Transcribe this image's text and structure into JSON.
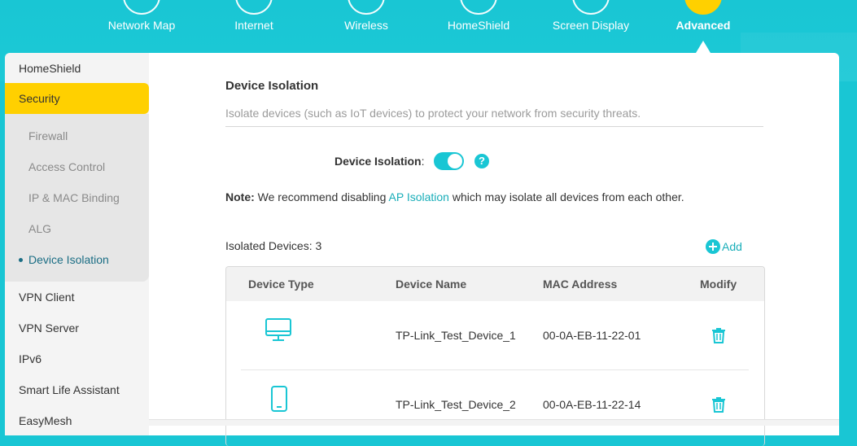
{
  "topnav": {
    "items": [
      {
        "label": "Network Map"
      },
      {
        "label": "Internet"
      },
      {
        "label": "Wireless"
      },
      {
        "label": "HomeShield"
      },
      {
        "label": "Screen Display"
      },
      {
        "label": "Advanced",
        "active": true
      }
    ]
  },
  "sidebar": {
    "items": [
      {
        "label": "HomeShield"
      },
      {
        "label": "Security",
        "active": true
      },
      {
        "label": "VPN Client"
      },
      {
        "label": "VPN Server"
      },
      {
        "label": "IPv6"
      },
      {
        "label": "Smart Life Assistant"
      },
      {
        "label": "EasyMesh"
      }
    ],
    "security_sub": [
      {
        "label": "Firewall"
      },
      {
        "label": "Access Control"
      },
      {
        "label": "IP & MAC Binding"
      },
      {
        "label": "ALG"
      },
      {
        "label": "Device Isolation",
        "current": true
      }
    ]
  },
  "main": {
    "title": "Device Isolation",
    "description": "Isolate devices (such as IoT devices) to protect your network from security threats.",
    "toggle_label": "Device Isolation",
    "toggle_colon": ":",
    "toggle_on": true,
    "help_glyph": "?",
    "note_prefix": "Note:",
    "note_text_1": " We recommend disabling ",
    "note_link": "AP Isolation",
    "note_text_2": " which may isolate all devices from each other.",
    "count_label": "Isolated Devices: 3",
    "add_label": "Add",
    "table": {
      "headers": [
        "Device Type",
        "Device Name",
        "MAC Address",
        "Modify"
      ],
      "rows": [
        {
          "type_icon": "monitor-icon",
          "name": "TP-Link_Test_Device_1",
          "mac": "00-0A-EB-11-22-01"
        },
        {
          "type_icon": "phone-icon",
          "name": "TP-Link_Test_Device_2",
          "mac": "00-0A-EB-11-22-14"
        }
      ]
    }
  },
  "colors": {
    "accent": "#19c6d4",
    "active_yellow": "#ffd000",
    "link": "#19aeb9"
  }
}
